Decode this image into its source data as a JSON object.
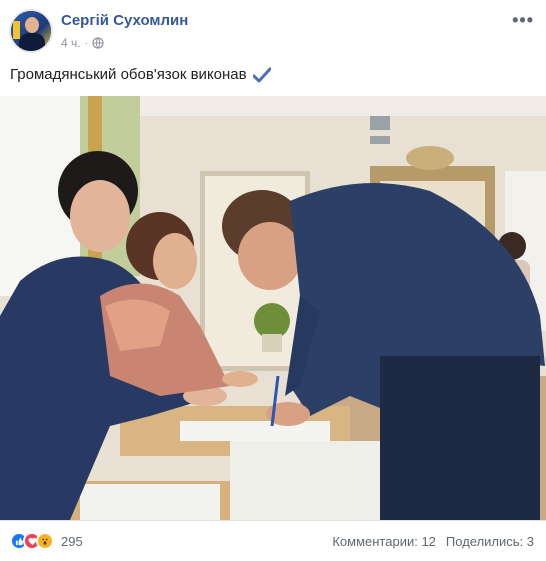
{
  "post": {
    "author": "Сергій Сухомлин",
    "time": "4 ч.",
    "privacy_icon": "globe-icon",
    "more_icon": "more-options-icon",
    "text": "Громадянський обов'язок виконав",
    "text_emoji": "check-mark-icon"
  },
  "footer": {
    "reaction_icons": [
      "like-icon",
      "love-icon",
      "wow-icon"
    ],
    "reaction_count": "295",
    "comments": "Комментарии: 12",
    "shares": "Поделились: 3"
  },
  "colors": {
    "author_link": "#385898",
    "secondary_text": "#606770",
    "like_blue": "#1877f2",
    "love_red": "#f33e58",
    "wow_yellow": "#f7b125"
  }
}
